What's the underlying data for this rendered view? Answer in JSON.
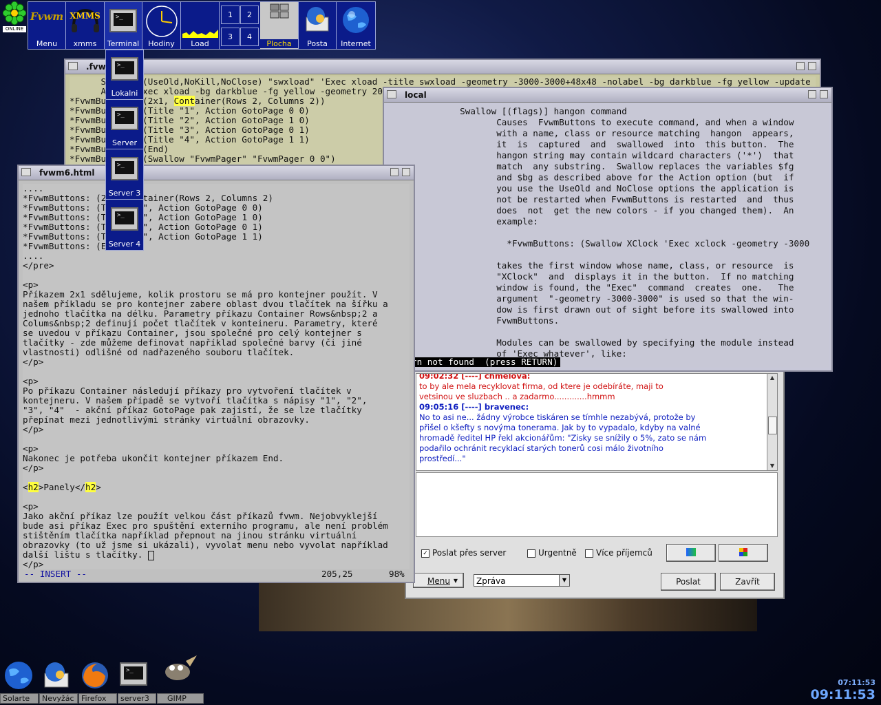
{
  "corner": {
    "online_label": "ONLINE"
  },
  "panel": {
    "buttons": [
      {
        "label": "Menu",
        "icon": "fvwm-logo"
      },
      {
        "label": "xmms",
        "icon": "xmms-headphones-icon",
        "title": "XMMS"
      },
      {
        "label": "Terminal",
        "icon": "terminal-icon"
      },
      {
        "label": "Hodiny",
        "icon": "clock-icon"
      },
      {
        "label": "Load",
        "icon": "load-graph-icon"
      },
      {
        "label": "Plocha",
        "icon": "pager-icon"
      },
      {
        "label": "Posta",
        "icon": "thunderbird-icon"
      },
      {
        "label": "Internet",
        "icon": "globe-icon"
      }
    ],
    "desks": [
      "1",
      "2",
      "3",
      "4"
    ]
  },
  "terminal_menu": {
    "items": [
      "Lokalni",
      "Server",
      "Server 3",
      "Server 4"
    ]
  },
  "win_fvwm": {
    "title": ".fvw",
    "lines": [
      "      Swallow (UseOld,NoKill,NoClose) \"swxload\" 'Exec xload -title swxload -geometry -3000-3000+48x48 -nolabel -bg darkblue -fg yellow -update 10', \\",
      "      Action Exec xload -bg darkblue -fg yellow -geometry 200x50",
      "*FvwmButtons: (2x1, Container(Rows 2, Columns 2))",
      "*FvwmButtons: (Title \"1\", Action GotoPage 0 0)",
      "*FvwmButtons: (Title \"2\", Action GotoPage 1 0)",
      "*FvwmButtons: (Title \"3\", Action GotoPage 0 1)",
      "*FvwmButtons: (Title \"4\", Action GotoPage 1 1)",
      "*FvwmButtons: (End)",
      "*FvwmButtons: (Swallow \"FvwmPager\" \"FvwmPager 0 0\")"
    ]
  },
  "win_vim": {
    "title": "fvwm6.html",
    "lines": [
      "....",
      "*FvwmButtons: (2x1, Container(Rows 2, Columns 2)",
      "*FvwmButtons: (Title \"1\", Action GotoPage 0 0)",
      "*FvwmButtons: (Title \"2\", Action GotoPage 1 0)",
      "*FvwmButtons: (Title \"3\", Action GotoPage 0 1)",
      "*FvwmButtons: (Title \"4\", Action GotoPage 1 1)",
      "*FvwmButtons: (End)",
      "....",
      "</pre>",
      "",
      "<p>",
      "Příkazem 2x1 sdělujeme, kolik prostoru se má pro kontejner použít. V",
      "našem příkladu se pro kontejner zabere oblast dvou tlačítek na šířku a",
      "jednoho tlačítka na délku. Parametry příkazu Container Rows&nbsp;2 a",
      "Colums&nbsp;2 definují počet tlačítek v konteineru. Parametry, které",
      "se uvedou v příkazu Container, jsou společné pro celý kontejner s",
      "tlačítky - zde můžeme definovat například společné barvy (či jiné",
      "vlastnosti) odlišné od nadřazeného souboru tlačítek.",
      "</p>",
      "",
      "<p>",
      "Po příkazu Container následují příkazy pro vytvoření tlačítek v",
      "kontejneru. V našem případě se vytvoří tlačítka s nápisy \"1\", \"2\",",
      "\"3\", \"4\"  - akční příkaz GotoPage pak zajistí, že se lze tlačítky",
      "přepínat mezi jednotlivými stránky virtuální obrazovky.",
      "</p>",
      "",
      "<p>",
      "Nakonec je potřeba ukončit kontejner příkazem End.",
      "</p>",
      "",
      "<h2>Panely</h2>",
      "",
      "<p>",
      "Jako akční příkaz lze použít velkou část příkazů fvwm. Nejobvyklejší",
      "bude asi příkaz Exec pro spuštění externího programu, ale není problém",
      "stištěním tlačítka například přepnout na jinou stránku virtuální",
      "obrazovky (to už jsme si ukázali), vyvolat menu nebo vyvolat například",
      "další lištu s tlačítky. ",
      "</p>"
    ],
    "mode": "-- INSERT --",
    "position": "205,25",
    "percent": "98%"
  },
  "win_local": {
    "title": "local",
    "lines": [
      "              Swallow [(flags)] hangon command",
      "                     Causes  FvwmButtons to execute command, and when a window",
      "                     with a name, class or resource matching  hangon  appears,",
      "                     it  is  captured  and  swallowed  into  this button.  The",
      "                     hangon string may contain wildcard characters ('*')  that",
      "                     match  any substring.  Swallow replaces the variables $fg",
      "                     and $bg as described above for the Action option (but  if",
      "                     you use the UseOld and NoClose options the application is",
      "                     not be restarted when FvwmButtons is restarted  and  thus",
      "                     does  not  get the new colors - if you changed them).  An",
      "                     example:",
      "",
      "                       *FvwmButtons: (Swallow XClock 'Exec xclock -geometry -3000",
      "",
      "                     takes the first window whose name, class, or resource  is",
      "                     \"XClock\"  and  displays it in the button.  If no matching",
      "                     window is found, the \"Exec\"  command  creates  one.   The",
      "                     argument  \"-geometry -3000-3000\" is used so that the win-",
      "                     dow is first drawn out of sight before its swallowed into",
      "                     FvwmButtons.",
      "",
      "                     Modules can be swallowed by specifying the module instead",
      "                     of 'Exec whatever', like:"
    ],
    "prompt": "rn not found  (press RETURN)"
  },
  "chat": {
    "messages": [
      {
        "header": "09:02:32 [----] chmelova:",
        "text": [
          "to by ale mela recyklovat firma, od ktere je odebíráte, maji to",
          "vetsinou ve sluzbach .. a zadarmo.............hmmm"
        ],
        "color": "#d01010"
      },
      {
        "header": "09:05:16 [----] bravenec:",
        "text": [
          "No to asi ne... žádny výrobce tiskáren se tímhle nezabývá, protože by",
          "přišel o kšefty s novýma tonerama. Jak by to vypadalo, kdyby na valné",
          "hromadě ředitel HP řekl akcionářům: \"Zisky se snížily o 5%, zato se nám",
          "podařilo ochránit recyklací starých tonerů cosi málo životního",
          "prostředí...\""
        ],
        "color": "#1020c0"
      }
    ],
    "opt_server": "Poslat přes server",
    "opt_urgent": "Urgentně",
    "opt_multi": "Více příjemců",
    "menu_label": "Menu",
    "type_value": "Zpráva",
    "send_label": "Poslat",
    "close_label": "Zavřít"
  },
  "taskbar": {
    "items": [
      "Solarte",
      "Nevyžác",
      "Firefox",
      "server3",
      "GIMP"
    ],
    "clock_small": "07:11:53",
    "clock_big": "09:11:53"
  }
}
